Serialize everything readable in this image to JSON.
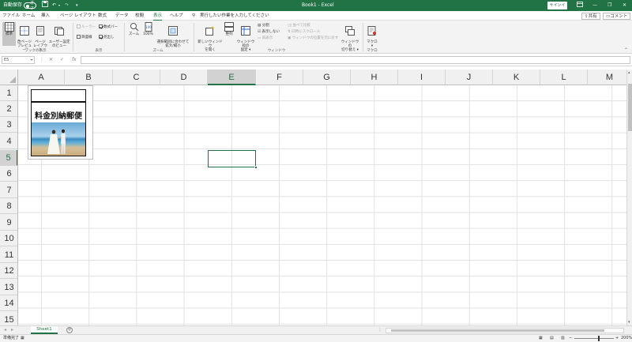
{
  "titlebar": {
    "autosave_label": "自動保存",
    "autosave_state": "オフ",
    "title": "Book1 - Excel",
    "signin": "サインイン"
  },
  "tabs": [
    "ファイル",
    "ホーム",
    "挿入",
    "ページ レイアウト",
    "数式",
    "データ",
    "校閲",
    "表示",
    "ヘルプ"
  ],
  "active_tab": "表示",
  "tell_me": "実行したい作業を入力してください",
  "share": "共有",
  "comment": "コメント",
  "ribbon": {
    "workbook_views": {
      "label": "ブックの表示",
      "normal": "標準",
      "page_break": "改ページ\nプレビュー",
      "page_layout": "ページ\nレイアウト",
      "custom": "ユーザー設定\nのビュー"
    },
    "show": {
      "label": "表示",
      "ruler": "ルーラー",
      "formula_bar": "数式バー",
      "gridlines": "目盛線",
      "headings": "見出し"
    },
    "zoom": {
      "label": "ズーム",
      "zoom": "ズーム",
      "hundred": "100%",
      "fit": "選択範囲に合わせて\n拡大/縮小"
    },
    "window": {
      "label": "ウィンドウ",
      "new_window": "新しいウィンドウ\nを開く",
      "arrange": "整列",
      "freeze": "ウィンドウ枠の\n固定 ▾",
      "split": "分割",
      "hide": "表示しない",
      "unhide": "再表示",
      "side_by_side": "並べて比較",
      "sync_scroll": "同時にスクロール",
      "reset_pos": "ウィンドウの位置を元に戻す",
      "switch": "ウィンドウの\n切り替え ▾"
    },
    "macros": {
      "label": "マクロ",
      "macro": "マクロ\n▾"
    }
  },
  "formula_bar": {
    "name_box": "E5",
    "value": ""
  },
  "columns": [
    "A",
    "B",
    "C",
    "D",
    "E",
    "F",
    "G",
    "H",
    "I",
    "J",
    "K",
    "L",
    "M"
  ],
  "rows": [
    "1",
    "2",
    "3",
    "4",
    "5",
    "6",
    "7",
    "8",
    "9",
    "10",
    "11",
    "12",
    "13",
    "14",
    "15"
  ],
  "selected_cell": {
    "column": "E",
    "row": "5"
  },
  "picture": {
    "text": "料金別納郵便"
  },
  "sheet_tab": "Sheet1",
  "status": {
    "ready": "準備完了",
    "zoom": "200%"
  },
  "colors": {
    "excel_green": "#217346"
  }
}
